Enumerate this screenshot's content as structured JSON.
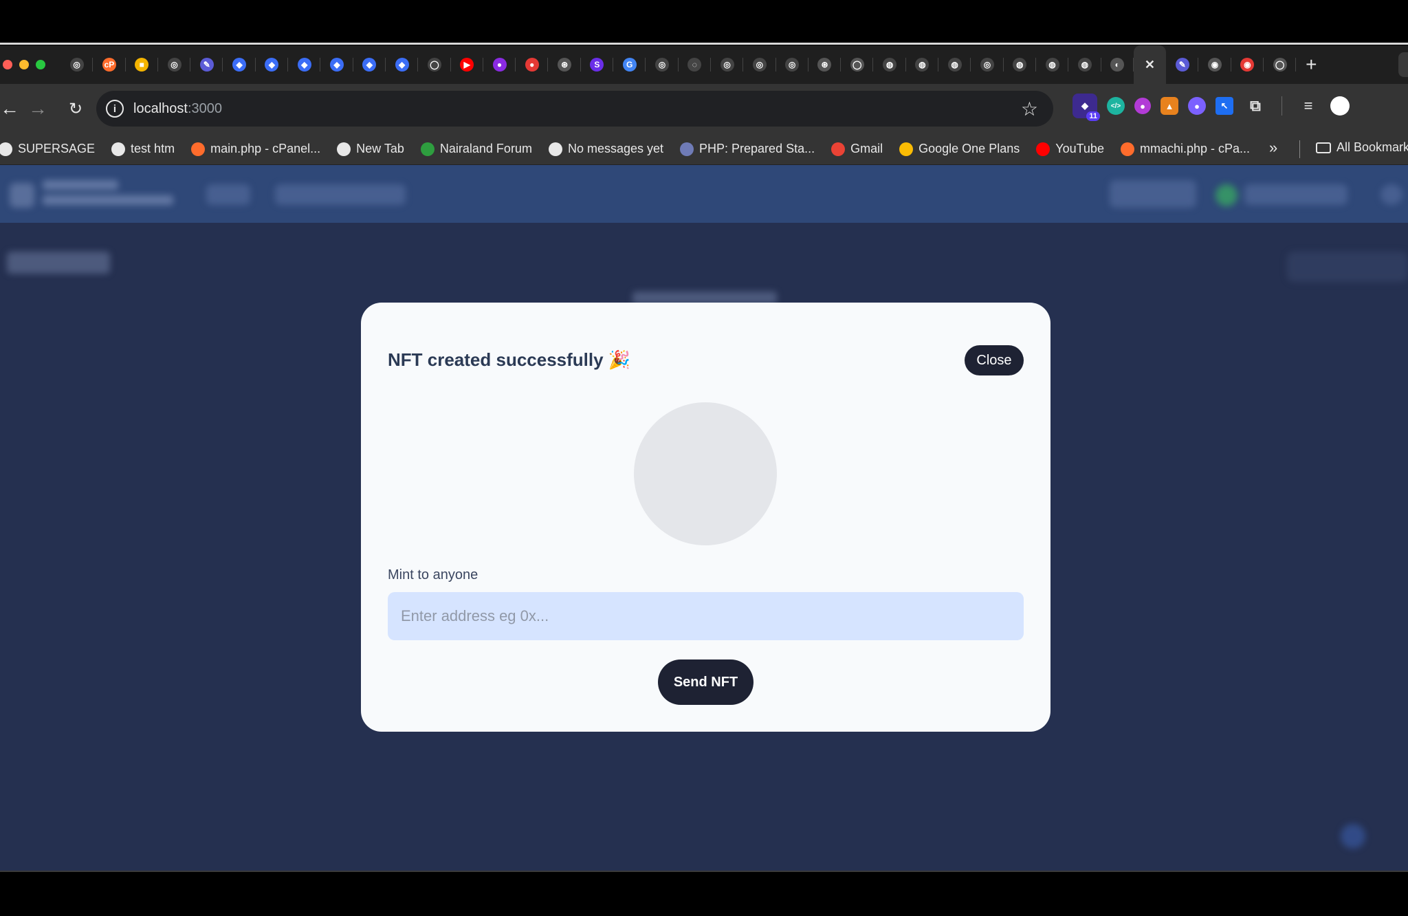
{
  "browser": {
    "tabs": [
      {
        "icon": "openai-icon",
        "color": "#444444",
        "glyph": "◎"
      },
      {
        "icon": "cpanel-icon",
        "color": "#ff6c2c",
        "glyph": "cP"
      },
      {
        "icon": "notes-icon",
        "color": "#f4b400",
        "glyph": "■"
      },
      {
        "icon": "openai-icon",
        "color": "#444444",
        "glyph": "◎"
      },
      {
        "icon": "tab-icon",
        "color": "#5b5bd6",
        "glyph": "✎"
      },
      {
        "icon": "diamond-icon",
        "color": "#3b6df6",
        "glyph": "◆"
      },
      {
        "icon": "diamond-icon",
        "color": "#3b6df6",
        "glyph": "◆"
      },
      {
        "icon": "diamond-icon",
        "color": "#3b6df6",
        "glyph": "◆"
      },
      {
        "icon": "diamond-icon",
        "color": "#3b6df6",
        "glyph": "◆"
      },
      {
        "icon": "diamond-icon",
        "color": "#3b6df6",
        "glyph": "◆"
      },
      {
        "icon": "diamond-icon",
        "color": "#3b6df6",
        "glyph": "◆"
      },
      {
        "icon": "github-icon",
        "color": "#444444",
        "glyph": "◯"
      },
      {
        "icon": "youtube-icon",
        "color": "#ff0000",
        "glyph": "▶"
      },
      {
        "icon": "tab-icon",
        "color": "#8a2be2",
        "glyph": "●"
      },
      {
        "icon": "tab-icon",
        "color": "#e53935",
        "glyph": "●"
      },
      {
        "icon": "tab-icon",
        "color": "#555555",
        "glyph": "⊛"
      },
      {
        "icon": "stripe-icon",
        "color": "#6a2ee8",
        "glyph": "S"
      },
      {
        "icon": "google-icon",
        "color": "#4285f4",
        "glyph": "G"
      },
      {
        "icon": "openai-icon",
        "color": "#444444",
        "glyph": "◎"
      },
      {
        "icon": "tab-icon",
        "color": "#444444",
        "glyph": "◌"
      },
      {
        "icon": "openai-icon",
        "color": "#444444",
        "glyph": "◎"
      },
      {
        "icon": "openai-icon",
        "color": "#444444",
        "glyph": "◎"
      },
      {
        "icon": "openai-icon",
        "color": "#444444",
        "glyph": "◎"
      },
      {
        "icon": "chatgpt-icon",
        "color": "#555555",
        "glyph": "⊛"
      },
      {
        "icon": "github-icon",
        "color": "#555555",
        "glyph": "◯"
      },
      {
        "icon": "tab-icon",
        "color": "#444444",
        "glyph": "◍"
      },
      {
        "icon": "tab-icon",
        "color": "#444444",
        "glyph": "◍"
      },
      {
        "icon": "tab-icon",
        "color": "#444444",
        "glyph": "◍"
      },
      {
        "icon": "openai-icon",
        "color": "#444444",
        "glyph": "◎"
      },
      {
        "icon": "tab-icon",
        "color": "#444444",
        "glyph": "◍"
      },
      {
        "icon": "tab-icon",
        "color": "#444444",
        "glyph": "◍"
      },
      {
        "icon": "tab-icon",
        "color": "#444444",
        "glyph": "◍"
      },
      {
        "icon": "globe-icon",
        "color": "#555555",
        "glyph": "◐"
      },
      {
        "icon": "close-icon",
        "color": "transparent",
        "glyph": "✕",
        "active": true
      },
      {
        "icon": "tab-icon",
        "color": "#5b5bd6",
        "glyph": "✎"
      },
      {
        "icon": "chrome-icon",
        "color": "#555555",
        "glyph": "◉"
      },
      {
        "icon": "record-icon",
        "color": "#e53935",
        "glyph": "◉"
      },
      {
        "icon": "github-icon",
        "color": "#555555",
        "glyph": "◯"
      }
    ],
    "new_tab_glyph": "+",
    "address": {
      "host": "localhost",
      "port": ":3000"
    },
    "extension_badge": "11",
    "bookmarks": [
      {
        "label": "SUPERSAGE",
        "icon": "globe-icon",
        "color": "#e8e8e8"
      },
      {
        "label": "test htm",
        "icon": "globe-icon",
        "color": "#e8e8e8"
      },
      {
        "label": "main.php - cPanel...",
        "icon": "cpanel-icon",
        "color": "#ff6c2c"
      },
      {
        "label": "New Tab",
        "icon": "globe-icon",
        "color": "#e8e8e8"
      },
      {
        "label": "Nairaland Forum",
        "icon": "nairaland-icon",
        "color": "#2e9e3f"
      },
      {
        "label": "No messages yet",
        "icon": "globe-icon",
        "color": "#e8e8e8"
      },
      {
        "label": "PHP: Prepared Sta...",
        "icon": "php-icon",
        "color": "#6f7bb6"
      },
      {
        "label": "Gmail",
        "icon": "gmail-icon",
        "color": "#ea4335"
      },
      {
        "label": "Google One Plans",
        "icon": "google-one-icon",
        "color": "#fbbc04"
      },
      {
        "label": "YouTube",
        "icon": "youtube-icon",
        "color": "#ff0000"
      },
      {
        "label": "mmachi.php - cPa...",
        "icon": "cpanel-icon",
        "color": "#ff6c2c"
      }
    ],
    "all_bookmarks": "All Bookmark"
  },
  "modal": {
    "title": "NFT created successfully 🎉",
    "close_label": "Close",
    "mint_label": "Mint to anyone",
    "address_placeholder": "Enter address eg 0x...",
    "send_label": "Send NFT"
  }
}
